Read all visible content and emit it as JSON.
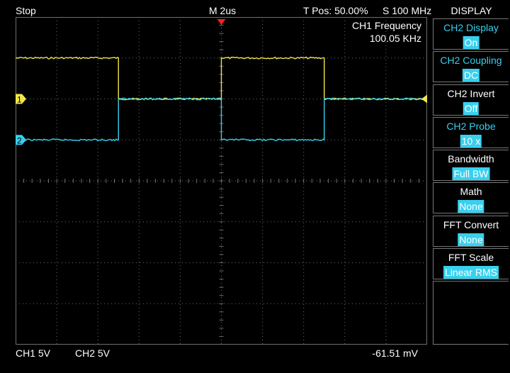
{
  "top_bar": {
    "status": "Stop",
    "timebase": "M 2us",
    "trigger_position": "T Pos: 50.00%",
    "sample_rate": "S 100 MHz"
  },
  "measurement": {
    "label": "CH1 Frequency",
    "value": "100.05 KHz"
  },
  "markers": {
    "ch1": "1",
    "ch2": "2"
  },
  "bottom_bar": {
    "ch1_scale": "CH1  5V",
    "ch2_scale": "CH2  5V",
    "trigger_level": "-61.51 mV"
  },
  "menu": {
    "title": "DISPLAY",
    "items": [
      {
        "label": "CH2 Display",
        "value": "On",
        "label_color": "cyan"
      },
      {
        "label": "CH2 Coupling",
        "value": "DC",
        "label_color": "cyan"
      },
      {
        "label": "CH2 Invert",
        "value": "Off",
        "label_color": "white"
      },
      {
        "label": "CH2 Probe",
        "value": "10 x",
        "label_color": "cyan"
      },
      {
        "label": "Bandwidth",
        "value": "Full BW",
        "label_color": "white"
      },
      {
        "label": "Math",
        "value": "None",
        "label_color": "white"
      },
      {
        "label": "FFT Convert",
        "value": "None",
        "label_color": "white"
      },
      {
        "label": "FFT Scale",
        "value": "Linear RMS",
        "label_color": "white"
      }
    ]
  },
  "colors": {
    "ch1": "#f0e64a",
    "ch2": "#38d0ee",
    "trigger_marker": "#ff2020",
    "grid": "#6e6e6e"
  },
  "chart_data": {
    "type": "line",
    "series": [
      {
        "name": "CH1",
        "x_divisions": [
          0,
          2.5,
          2.5,
          5,
          5,
          7.5,
          7.5,
          10
        ],
        "y_divisions": [
          3,
          3,
          2,
          2,
          3,
          3,
          2,
          2
        ]
      },
      {
        "name": "CH2",
        "x_divisions": [
          0,
          2.5,
          2.5,
          5,
          5,
          7.5,
          7.5,
          10
        ],
        "y_divisions": [
          1,
          1,
          2,
          2,
          1,
          1,
          2,
          2
        ]
      }
    ],
    "xlim": [
      0,
      10
    ],
    "ylim": [
      -4,
      4
    ],
    "grid": true
  }
}
